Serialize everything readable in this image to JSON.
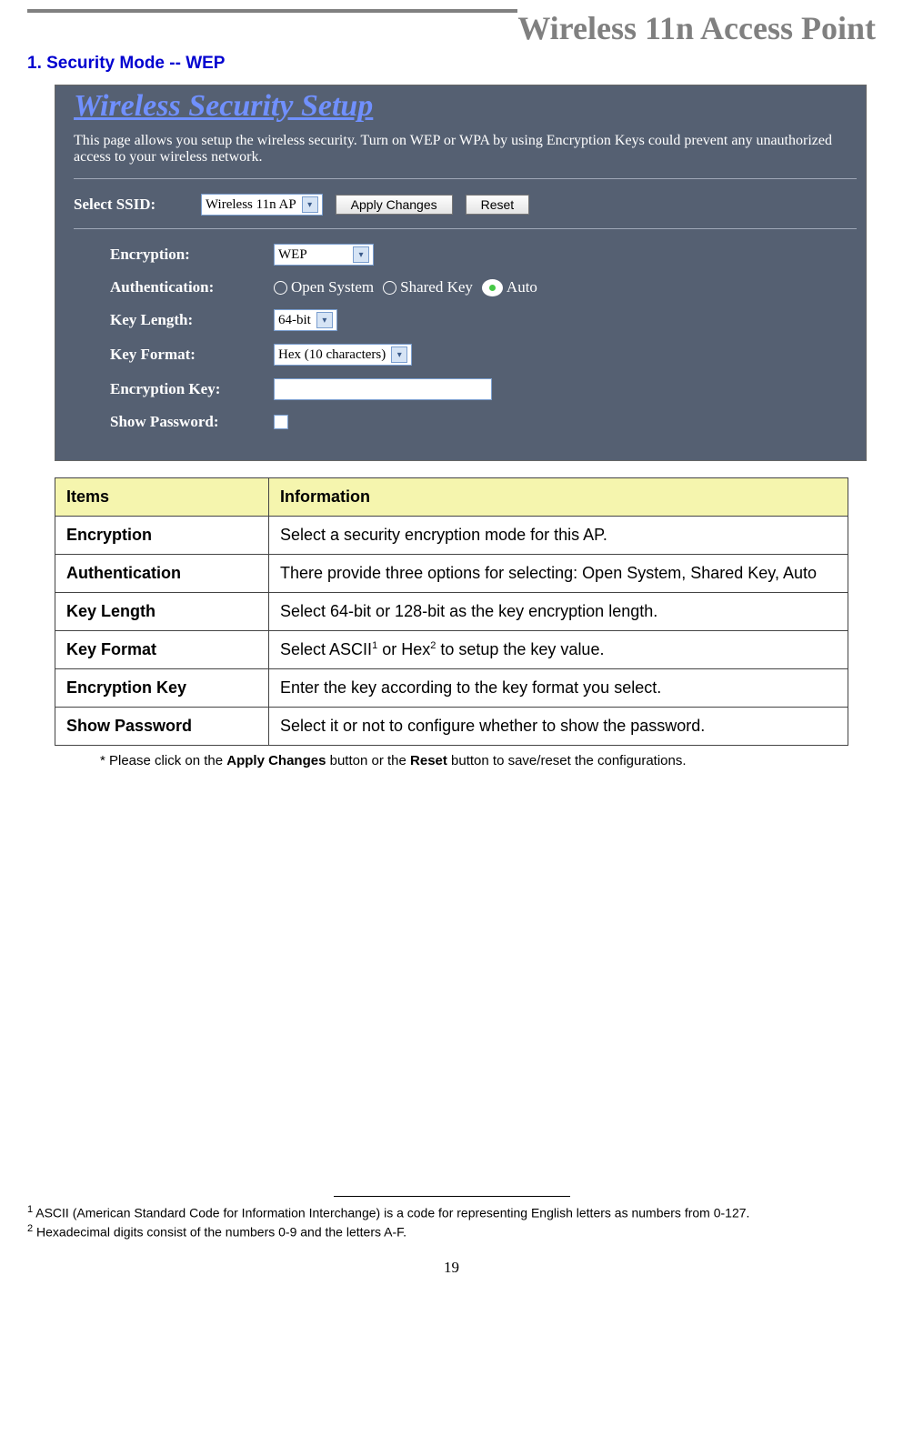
{
  "header": {
    "title": "Wireless 11n Access Point"
  },
  "section_title": "1. Security Mode -- WEP",
  "panel": {
    "title": "Wireless Security Setup",
    "desc": "This page allows you setup the wireless security. Turn on WEP or WPA by using Encryption Keys could prevent any unauthorized access to your wireless network.",
    "ssid_label": "Select SSID:",
    "ssid_value": "Wireless 11n AP",
    "apply_btn": "Apply Changes",
    "reset_btn": "Reset",
    "fields": {
      "encryption_label": "Encryption:",
      "encryption_value": "WEP",
      "auth_label": "Authentication:",
      "auth_options": {
        "open": "Open System",
        "shared": "Shared Key",
        "auto": "Auto"
      },
      "keylen_label": "Key Length:",
      "keylen_value": "64-bit",
      "keyfmt_label": "Key Format:",
      "keyfmt_value": "Hex (10 characters)",
      "enckey_label": "Encryption Key:",
      "showpw_label": "Show Password:"
    }
  },
  "table": {
    "head_items": "Items",
    "head_info": "Information",
    "rows": [
      {
        "item": "Encryption",
        "info": "Select a security encryption mode for this AP."
      },
      {
        "item": "Authentication",
        "info": "There provide three options for selecting: Open System, Shared Key, Auto"
      },
      {
        "item": "Key Length",
        "info": "Select 64-bit or 128-bit as the key encryption length."
      },
      {
        "item": "Key Format",
        "info_pre": "Select ASCII",
        "sup1": "1",
        "info_mid": " or Hex",
        "sup2": "2",
        "info_post": " to setup the key value."
      },
      {
        "item": "Encryption Key",
        "info": "Enter the key according to the key format you select."
      },
      {
        "item": "Show Password",
        "info": "Select it or not to configure whether to show the password."
      }
    ]
  },
  "note": {
    "pre": "* Please click on the ",
    "b1": "Apply Changes",
    "mid": " button or the ",
    "b2": "Reset",
    "post": " button to save/reset the configurations."
  },
  "footnotes": {
    "f1_sup": "1",
    "f1": " ASCII (American Standard Code for Information Interchange) is a code for representing English letters as numbers from 0-127.",
    "f2_sup": "2",
    "f2": " Hexadecimal digits consist of the numbers 0-9 and the letters A-F."
  },
  "page_no": "19"
}
